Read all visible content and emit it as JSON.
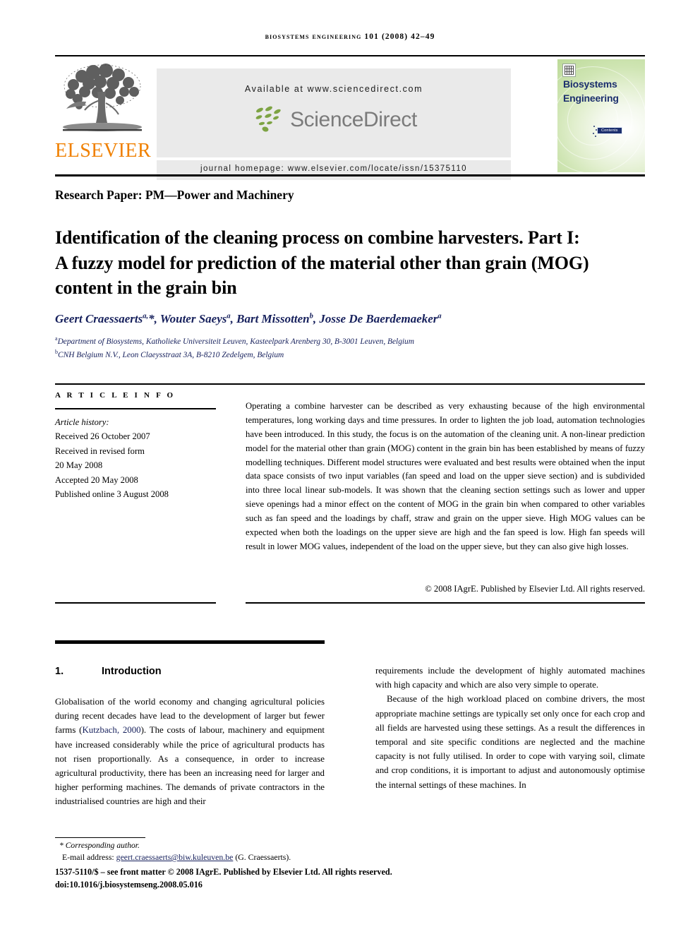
{
  "running_head": "Biosystems Engineering 101 (2008) 42–49",
  "masthead": {
    "publisher_name": "ELSEVIER",
    "publisher_logo_icon": "elsevier-tree-icon",
    "available_at": "Available at www.sciencedirect.com",
    "sciencedirect_wordmark": "ScienceDirect",
    "sciencedirect_leaf_icon": "sciencedirect-leaf-icon",
    "journal_homepage": "journal homepage: www.elsevier.com/locate/issn/15375110",
    "cover": {
      "title_line1": "Biosystems",
      "title_line2": "Engineering",
      "badge": "Contents",
      "corner_icon": "journal-cover-thumbnail-icon"
    }
  },
  "article": {
    "section_label": "Research Paper: PM—Power and Machinery",
    "title": "Identification of the cleaning process on combine harvesters. Part I: A fuzzy model for prediction of the material other than grain (MOG) content in the grain bin",
    "authors_html": "Geert Craessaerts<sup>a,</sup>*, Wouter Saeys<sup>a</sup>, Bart Missotten<sup>b</sup>, Josse De Baerdemaeker<sup>a</sup>",
    "affiliations": [
      {
        "marker": "a",
        "text": "Department of Biosystems, Katholieke Universiteit Leuven, Kasteelpark Arenberg 30, B-3001 Leuven, Belgium"
      },
      {
        "marker": "b",
        "text": "CNH Belgium N.V., Leon Claeysstraat 3A, B-8210 Zedelgem, Belgium"
      }
    ]
  },
  "article_info": {
    "heading": "A R T I C L E   I N F O",
    "history_label": "Article history:",
    "history_lines": [
      "Received 26 October 2007",
      "Received in revised form",
      "20 May 2008",
      "Accepted 20 May 2008",
      "Published online 3 August 2008"
    ]
  },
  "abstract": {
    "text": "Operating a combine harvester can be described as very exhausting because of the high environmental temperatures, long working days and time pressures. In order to lighten the job load, automation technologies have been introduced. In this study, the focus is on the automation of the cleaning unit. A non-linear prediction model for the material other than grain (MOG) content in the grain bin has been established by means of fuzzy modelling techniques. Different model structures were evaluated and best results were obtained when the input data space consists of two input variables (fan speed and load on the upper sieve section) and is subdivided into three local linear sub-models. It was shown that the cleaning section settings such as lower and upper sieve openings had a minor effect on the content of MOG in the grain bin when compared to other variables such as fan speed and the loadings by chaff, straw and grain on the upper sieve. High MOG values can be expected when both the loadings on the upper sieve are high and the fan speed is low. High fan speeds will result in lower MOG values, independent of the load on the upper sieve, but they can also give high losses.",
    "copyright": "© 2008 IAgrE. Published by Elsevier Ltd. All rights reserved."
  },
  "body": {
    "section_number": "1.",
    "section_title": "Introduction",
    "left_column_html": "Globalisation of the world economy and changing agricultural policies during recent decades have lead to the development of larger but fewer farms (<span class=\"cite\">Kutzbach, 2000</span>). The costs of labour, machinery and equipment have increased considerably while the price of agricultural products has not risen proportionally. As a consequence, in order to increase agricultural productivity, there has been an increasing need for larger and higher performing machines. The demands of private contractors in the industrialised countries are high and their",
    "right_paragraph_1": "requirements include the development of highly automated machines with high capacity and which are also very simple to operate.",
    "right_paragraph_2": "Because of the high workload placed on combine drivers, the most appropriate machine settings are typically set only once for each crop and all fields are harvested using these settings. As a result the differences in temporal and site specific conditions are neglected and the machine capacity is not fully utilised. In order to cope with varying soil, climate and crop conditions, it is important to adjust and autonomously optimise the internal settings of these machines. In"
  },
  "footnotes": {
    "corresponding_author": "* Corresponding author.",
    "email_label": "E-mail address:",
    "email_address": "geert.craessaerts@biw.kuleuven.be",
    "email_suffix": "(G. Craessaerts).",
    "issn_line": "1537-5110/$ – see front matter © 2008 IAgrE. Published by Elsevier Ltd. All rights reserved.",
    "doi_line": "doi:10.1016/j.biosystemseng.2008.05.016"
  },
  "colors": {
    "elsevier_orange": "#F08000",
    "link_blue": "#16205c",
    "band_grey": "#EAEAEA",
    "sciencedirect_grey": "#7b7b7b",
    "leaf_green": "#7DA343",
    "cover_green": "#cfe5b3"
  }
}
